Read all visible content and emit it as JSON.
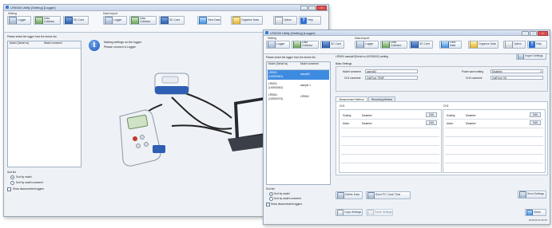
{
  "window1": {
    "title": "LR5000 Utility [Setting] [Logger]",
    "ribbon": {
      "group_setting": "Setting",
      "group_data_import": "Data Import",
      "buttons": [
        "Logger",
        "Data Collector",
        "SD Card",
        "Logger",
        "Data Collector",
        "SD Card",
        "View Data",
        "Organize Data",
        "Option",
        "Help"
      ]
    },
    "left_prompt": "Please select the logger from the device list.",
    "list_columns": [
      "Model (Serial no)",
      "Model comment"
    ],
    "sort_list": {
      "label": "Sort list",
      "options": [
        "Sort by model",
        "Sort by model comment"
      ],
      "selected": 0
    },
    "show_disconnected": "Show disconnected loggers",
    "message_lines": [
      "Making settings on the logger.",
      "Please connect a Logger."
    ]
  },
  "window2": {
    "title": "LR5000 Utility [Setting] [Logger]",
    "ribbon": {
      "group_setting": "Setting",
      "group_data_import": "Data Import",
      "buttons": [
        "Logger",
        "Data Collector",
        "SD Card",
        "Logger",
        "Data Collector",
        "SD Card",
        "View Data",
        "Organize Data",
        "Option",
        "Help"
      ]
    },
    "left_prompt": "Please select the logger from the device list.",
    "list_columns": [
      "Model (Serial no)",
      "Model comment"
    ],
    "devices": [
      {
        "model": "LR5011",
        "serial": "(100930001)",
        "comment": "sample2",
        "selected": true
      },
      {
        "model": "LR5011",
        "serial": "(100930002)",
        "comment": "sample 1",
        "selected": false
      },
      {
        "model": "LR5041",
        "serial": "(100930073)",
        "comment": "LR5041",
        "selected": false
      }
    ],
    "header_line": "LR5001 sample2(Serial no:100930001) setting",
    "import_settings": "Import Settings",
    "basic_settings": {
      "label": "Basic Settings",
      "model_comment_label": "Model comment",
      "model_comment_value": "sample2",
      "ch1_comment_label": "CH1 comment",
      "ch1_comment_value": "2ndFloor TEMP",
      "power_save_label": "Power save setting",
      "power_save_value": "Disabled",
      "ch2_comment_label": "CH2 comment",
      "ch2_comment_value": "2ndFloor HU"
    },
    "tabs": [
      "Measurement Method",
      "Recording Method"
    ],
    "active_tab": 0,
    "ch1": {
      "label": "CH1",
      "rows": [
        {
          "name": "Scaling",
          "value": "Disabled",
          "button": "Edit"
        },
        {
          "name": "Alarm",
          "value": "Disabled",
          "button": "Edit"
        }
      ]
    },
    "ch2": {
      "label": "CH2",
      "rows": [
        {
          "name": "Scaling",
          "value": "Disabled",
          "button": "Edit"
        },
        {
          "name": "Alarm",
          "value": "Disabled",
          "button": "Edit"
        }
      ]
    },
    "sort_list": {
      "label": "Sort list",
      "options": [
        "Sort by model",
        "Sort by model comment"
      ],
      "selected": 0
    },
    "show_disconnected": "Show disconnected loggers",
    "show_disconnected_checked": true,
    "bottom_buttons": [
      "Delete Data",
      "Send PC Clock Time",
      "Send Settings"
    ],
    "footer_buttons": [
      "Copy Settings",
      "Paste Settings",
      "Home"
    ],
    "status_time": "2011/01/20 20:40"
  }
}
